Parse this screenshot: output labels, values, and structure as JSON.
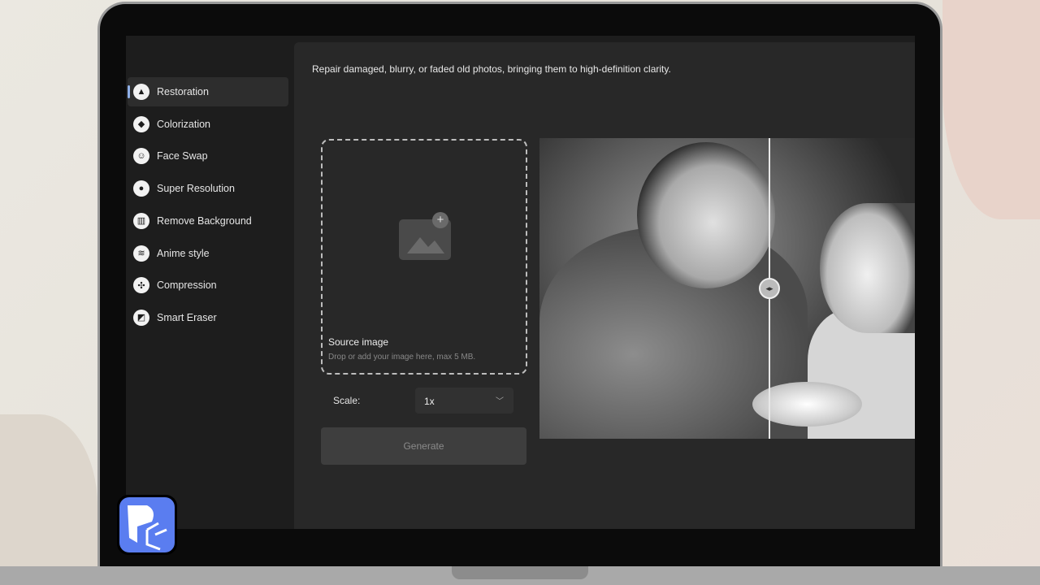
{
  "sidebar": {
    "items": [
      {
        "label": "Restoration",
        "icon": "restoration-icon",
        "glyph": "▲",
        "active": true
      },
      {
        "label": "Colorization",
        "icon": "colorization-icon",
        "glyph": "◆"
      },
      {
        "label": "Face Swap",
        "icon": "face-swap-icon",
        "glyph": "☺"
      },
      {
        "label": "Super Resolution",
        "icon": "super-resolution-icon",
        "glyph": "●"
      },
      {
        "label": "Remove Background",
        "icon": "remove-background-icon",
        "glyph": "▥"
      },
      {
        "label": "Anime style",
        "icon": "anime-style-icon",
        "glyph": "≋"
      },
      {
        "label": "Compression",
        "icon": "compression-icon",
        "glyph": "✣"
      },
      {
        "label": "Smart Eraser",
        "icon": "smart-eraser-icon",
        "glyph": "◩"
      }
    ]
  },
  "main": {
    "description": "Repair damaged, blurry, or faded old photos, bringing them to high-definition clarity.",
    "upload": {
      "title": "Source image",
      "hint": "Drop or add your image here, max 5 MB.",
      "plus": "+"
    },
    "scale": {
      "label": "Scale:",
      "value": "1x",
      "chevron": "﹀"
    },
    "generate_label": "Generate",
    "compare_handle": "◂▸"
  },
  "colors": {
    "accent": "#5a7df0",
    "panel": "#282828",
    "sidebar": "#1d1d1d"
  }
}
